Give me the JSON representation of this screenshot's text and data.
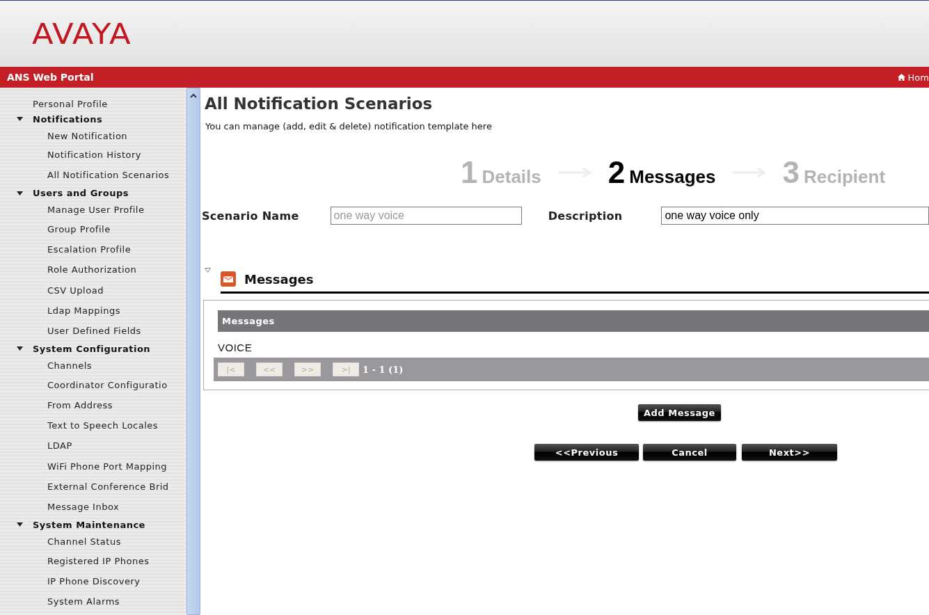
{
  "header": {
    "logo": "AVAYA",
    "portal_title": "ANS Web Portal",
    "home_link": "Hom"
  },
  "sidebar": {
    "items": [
      {
        "label": "Personal Profile"
      },
      {
        "label": "Notifications",
        "expanded": true,
        "children": [
          {
            "label": "New Notification"
          },
          {
            "label": "Notification History"
          },
          {
            "label": "All Notification Scenarios"
          }
        ]
      },
      {
        "label": "Users and Groups",
        "expanded": true,
        "children": [
          {
            "label": "Manage User Profile"
          },
          {
            "label": "Group Profile"
          },
          {
            "label": "Escalation Profile"
          },
          {
            "label": "Role Authorization"
          },
          {
            "label": "CSV Upload"
          },
          {
            "label": "Ldap Mappings"
          },
          {
            "label": "User Defined Fields"
          }
        ]
      },
      {
        "label": "System Configuration",
        "expanded": true,
        "children": [
          {
            "label": "Channels"
          },
          {
            "label": "Coordinator Configuratio"
          },
          {
            "label": "From Address"
          },
          {
            "label": "Text to Speech Locales"
          },
          {
            "label": "LDAP"
          },
          {
            "label": "WiFi Phone Port Mapping"
          },
          {
            "label": "External Conference Brid"
          },
          {
            "label": "Message Inbox"
          }
        ]
      },
      {
        "label": "System Maintenance",
        "expanded": true,
        "children": [
          {
            "label": "Channel Status"
          },
          {
            "label": "Registered IP Phones"
          },
          {
            "label": "IP Phone Discovery"
          },
          {
            "label": "System Alarms"
          }
        ]
      }
    ]
  },
  "page": {
    "title": "All Notification Scenarios",
    "subtitle": "You can manage (add, edit & delete) notification template here"
  },
  "steps": [
    {
      "number": "1",
      "label": "Details",
      "selected": false
    },
    {
      "number": "2",
      "label": "Messages",
      "selected": true
    },
    {
      "number": "3",
      "label": "Recipient",
      "selected": false
    }
  ],
  "form": {
    "scenario_name": {
      "label": "Scenario Name",
      "value": "one way voice",
      "disabled": true
    },
    "description": {
      "label": "Description",
      "value": "one way voice only",
      "disabled": false
    }
  },
  "messages_section": {
    "title": "Messages",
    "expanded": true,
    "table": {
      "columns": [
        "Messages"
      ],
      "rows": [
        "VOICE"
      ]
    },
    "pager": {
      "buttons": [
        "|<",
        "<<",
        ">>",
        ">|"
      ],
      "range": "1 - 1 (1)"
    }
  },
  "buttons": {
    "add": "Add Message",
    "nav": [
      "<<Previous",
      "Cancel",
      "Next>>"
    ]
  }
}
